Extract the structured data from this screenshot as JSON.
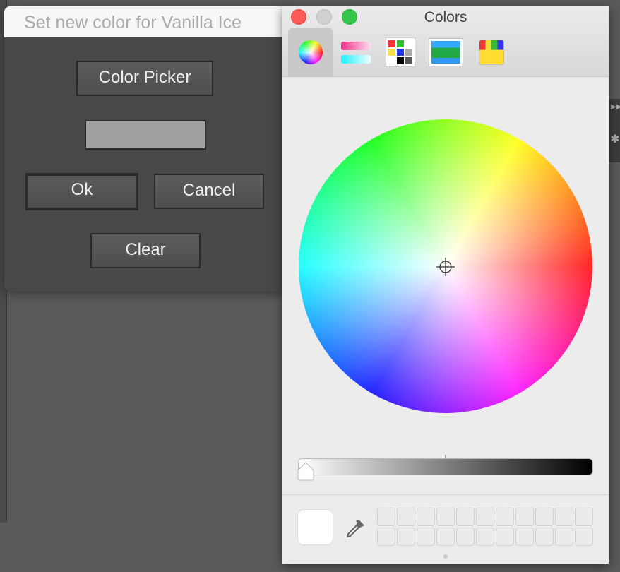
{
  "dialog": {
    "title": "Set new color for Vanilla Ice",
    "color_picker_label": "Color Picker",
    "ok_label": "Ok",
    "cancel_label": "Cancel",
    "clear_label": "Clear",
    "current_color": "#a0a0a0"
  },
  "colors_panel": {
    "title": "Colors",
    "tabs": [
      {
        "icon": "color-wheel-icon",
        "selected": true
      },
      {
        "icon": "color-sliders-icon"
      },
      {
        "icon": "color-palettes-icon"
      },
      {
        "icon": "image-palettes-icon"
      },
      {
        "icon": "crayons-icon"
      }
    ],
    "brightness_percent": 100,
    "selected_color": "#ffffff",
    "swatch_slots": 22
  }
}
